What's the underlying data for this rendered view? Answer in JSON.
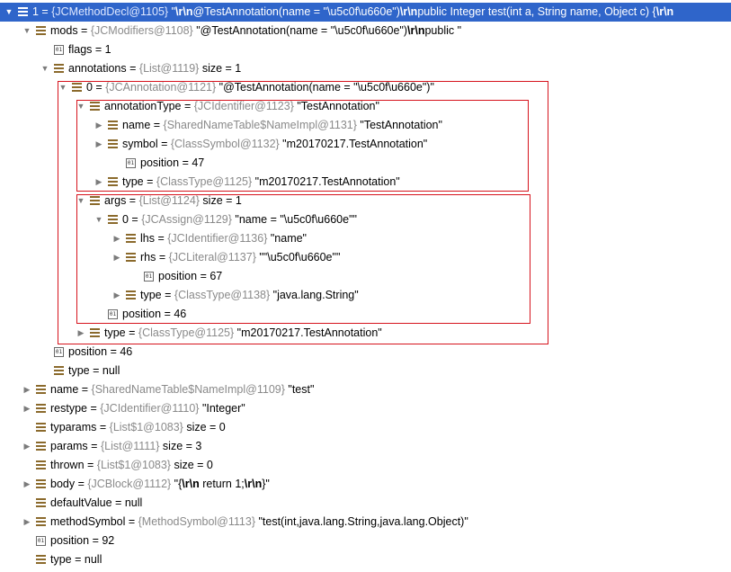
{
  "rows": [
    {
      "arrow": "down",
      "icon": "field",
      "name": "1",
      "sep": " = ",
      "ref": "{JCMethodDecl@1105}",
      "value_parts": [
        " \"",
        {
          "b": "\\r\\n"
        },
        "@TestAnnotation(name = \"\\u5c0f\\u660e\")",
        {
          "b": "\\r\\n"
        },
        "public Integer test(int a, String name, Object c) {",
        {
          "b": "\\r\\n"
        }
      ],
      "selected": true
    },
    {
      "arrow": "down",
      "icon": "field",
      "name": "mods",
      "sep": " = ",
      "ref": "{JCModifiers@1108}",
      "value_parts": [
        " \"@TestAnnotation(name = \"\\u5c0f\\u660e\")",
        {
          "b": "\\r\\n"
        },
        "public \""
      ]
    },
    {
      "arrow": "",
      "icon": "prim",
      "name": "flags",
      "sep": " = ",
      "ref": "",
      "value_parts": [
        "1"
      ]
    },
    {
      "arrow": "down",
      "icon": "field",
      "name": "annotations",
      "sep": " = ",
      "ref": "{List@1119}",
      "value_parts": [
        "  size = 1"
      ]
    },
    {
      "arrow": "down",
      "icon": "field",
      "name": "0",
      "sep": " = ",
      "ref": "{JCAnnotation@1121}",
      "value_parts": [
        " \"@TestAnnotation(name = \"\\u5c0f\\u660e\")\""
      ]
    },
    {
      "arrow": "down",
      "icon": "field",
      "name": "annotationType",
      "sep": " = ",
      "ref": "{JCIdentifier@1123}",
      "value_parts": [
        " \"TestAnnotation\""
      ]
    },
    {
      "arrow": "right",
      "icon": "field",
      "name": "name",
      "sep": " = ",
      "ref": "{SharedNameTable$NameImpl@1131}",
      "value_parts": [
        " \"TestAnnotation\""
      ]
    },
    {
      "arrow": "right",
      "icon": "field",
      "name": "symbol",
      "sep": " = ",
      "ref": "{ClassSymbol@1132}",
      "value_parts": [
        " \"m20170217.TestAnnotation\""
      ]
    },
    {
      "arrow": "",
      "icon": "prim",
      "name": "position",
      "sep": " = ",
      "ref": "",
      "value_parts": [
        "47"
      ]
    },
    {
      "arrow": "right",
      "icon": "field",
      "name": "type",
      "sep": " = ",
      "ref": "{ClassType@1125}",
      "value_parts": [
        " \"m20170217.TestAnnotation\""
      ]
    },
    {
      "arrow": "down",
      "icon": "field",
      "name": "args",
      "sep": " = ",
      "ref": "{List@1124}",
      "value_parts": [
        "  size = 1"
      ]
    },
    {
      "arrow": "down",
      "icon": "field",
      "name": "0",
      "sep": " = ",
      "ref": "{JCAssign@1129}",
      "value_parts": [
        " \"name = \"\\u5c0f\\u660e\"\""
      ]
    },
    {
      "arrow": "right",
      "icon": "field",
      "name": "lhs",
      "sep": " = ",
      "ref": "{JCIdentifier@1136}",
      "value_parts": [
        " \"name\""
      ]
    },
    {
      "arrow": "right",
      "icon": "field",
      "name": "rhs",
      "sep": " = ",
      "ref": "{JCLiteral@1137}",
      "value_parts": [
        " \"\"\\u5c0f\\u660e\"\""
      ]
    },
    {
      "arrow": "",
      "icon": "prim",
      "name": "position",
      "sep": " = ",
      "ref": "",
      "value_parts": [
        "67"
      ]
    },
    {
      "arrow": "right",
      "icon": "field",
      "name": "type",
      "sep": " = ",
      "ref": "{ClassType@1138}",
      "value_parts": [
        " \"java.lang.String\""
      ]
    },
    {
      "arrow": "",
      "icon": "prim",
      "name": "position",
      "sep": " = ",
      "ref": "",
      "value_parts": [
        "46"
      ]
    },
    {
      "arrow": "right",
      "icon": "field",
      "name": "type",
      "sep": " = ",
      "ref": "{ClassType@1125}",
      "value_parts": [
        " \"m20170217.TestAnnotation\""
      ]
    },
    {
      "arrow": "",
      "icon": "prim",
      "name": "position",
      "sep": " = ",
      "ref": "",
      "value_parts": [
        "46"
      ]
    },
    {
      "arrow": "",
      "icon": "field",
      "name": "type",
      "sep": " = ",
      "ref": "",
      "value_parts": [
        "null"
      ]
    },
    {
      "arrow": "right",
      "icon": "field",
      "name": "name",
      "sep": " = ",
      "ref": "{SharedNameTable$NameImpl@1109}",
      "value_parts": [
        " \"test\""
      ]
    },
    {
      "arrow": "right",
      "icon": "field",
      "name": "restype",
      "sep": " = ",
      "ref": "{JCIdentifier@1110}",
      "value_parts": [
        " \"Integer\""
      ]
    },
    {
      "arrow": "",
      "icon": "field",
      "name": "typarams",
      "sep": " = ",
      "ref": "{List$1@1083}",
      "value_parts": [
        "  size = 0"
      ]
    },
    {
      "arrow": "right",
      "icon": "field",
      "name": "params",
      "sep": " = ",
      "ref": "{List@1111}",
      "value_parts": [
        "  size = 3"
      ]
    },
    {
      "arrow": "",
      "icon": "field",
      "name": "thrown",
      "sep": " = ",
      "ref": "{List$1@1083}",
      "value_parts": [
        "  size = 0"
      ]
    },
    {
      "arrow": "right",
      "icon": "field",
      "name": "body",
      "sep": " = ",
      "ref": "{JCBlock@1112}",
      "value_parts": [
        " \"{",
        {
          "b": "\\r\\n"
        },
        "    return 1;",
        {
          "b": "\\r\\n"
        },
        "}\""
      ]
    },
    {
      "arrow": "",
      "icon": "field",
      "name": "defaultValue",
      "sep": " = ",
      "ref": "",
      "value_parts": [
        "null"
      ]
    },
    {
      "arrow": "right",
      "icon": "field",
      "name": "methodSymbol",
      "sep": " = ",
      "ref": "{MethodSymbol@1113}",
      "value_parts": [
        " \"test(int,java.lang.String,java.lang.Object)\""
      ]
    },
    {
      "arrow": "",
      "icon": "prim",
      "name": "position",
      "sep": " = ",
      "ref": "",
      "value_parts": [
        "92"
      ]
    },
    {
      "arrow": "",
      "icon": "field",
      "name": "type",
      "sep": " = ",
      "ref": "",
      "value_parts": [
        "null"
      ]
    }
  ],
  "prim_icon_glyph": "01",
  "colors": {
    "selection": "#2f65ca",
    "highlight_box": "#d6141d",
    "field_icon": "#8b6a2c",
    "ref_text": "#8a8a8a"
  }
}
